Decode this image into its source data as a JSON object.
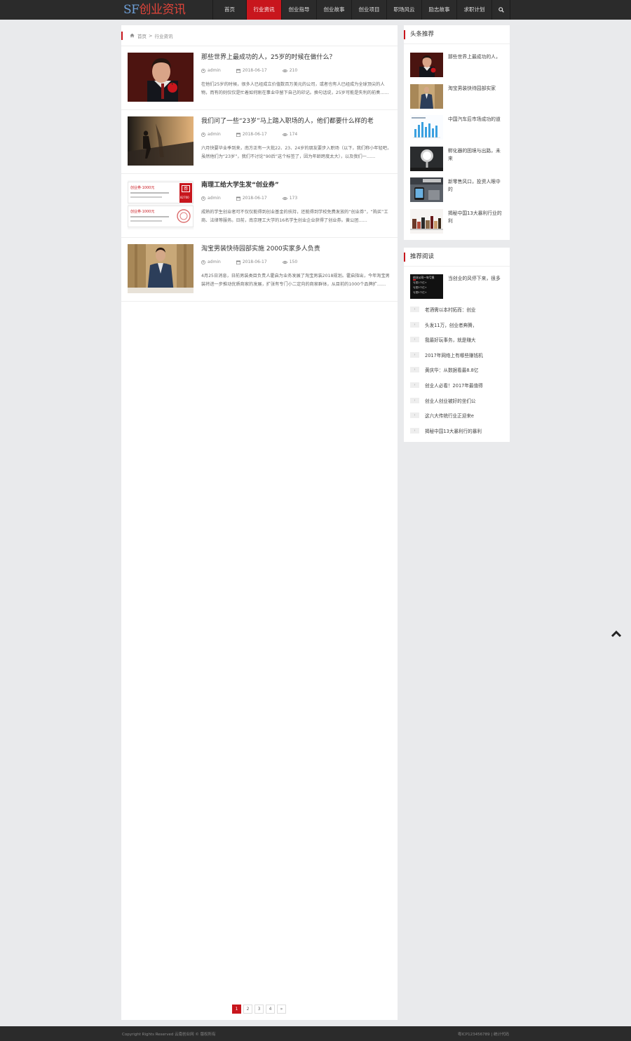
{
  "logo": {
    "sf": "SF",
    "cn": "创业资讯"
  },
  "nav": {
    "items": [
      "首页",
      "行业资讯",
      "创业指导",
      "创业故事",
      "创业项目",
      "职场风云",
      "励志故事",
      "求职计划"
    ],
    "active_index": 1
  },
  "breadcrumb": {
    "home": "首页",
    "separator": ">",
    "current": "行业资讯"
  },
  "articles": [
    {
      "title": "那些世界上最成功的人，25岁的时候在做什么？",
      "author": "admin",
      "date": "2018-06-17",
      "views": "210",
      "excerpt": "在他们25岁的时候，很多人已经成立价值数百万美元的公司，或者也有人已经成为全球顶尖的人物，而有的则仅仅是忙着如何刚在事业中留下自己的印记。换句话说，25岁可能是失利的前奏……"
    },
    {
      "title": "我们问了一些“23岁”马上踏入职场的人，他们都要什么样的老",
      "author": "admin",
      "date": "2018-06-17",
      "views": "174",
      "excerpt": "六月快要毕业季到来，南方正有一大批22、23、24岁的朋友要步入职场（以下，我们称小年轻吧，虽然他们为“23岁”，我们不讨论“90后”这个标签了，因为年龄跨度太大），以及我们一……"
    },
    {
      "title": "南理工给大学生发“创业券”",
      "author": "admin",
      "date": "2018-06-17",
      "views": "173",
      "excerpt": "成熟的学生创业者可不仅仅能得到创业基金的扶持，还能得到学校免费发放的“创业券”，“购买”工商、法律等服务。日前，南京理工大学的16名学生创业企业获得了创业券。黄公团……"
    },
    {
      "title": "淘宝男装快待园部实施 2000实家多人负责",
      "author": "admin",
      "date": "2018-06-17",
      "views": "150",
      "excerpt": "4月25日消息，日前男装类目负责人霍启为业务发展了淘宝男装2018规划。霍启指出，今年淘宝男装将进一步推动优质商家的发展，扩张有专门小二定向的商家群体，从目前的1000个品牌扩……"
    }
  ],
  "voucher_image": {
    "line1": "创业券·1000元",
    "line2": "创业券·1000元",
    "stamp": "券",
    "code": "82700"
  },
  "pagination": {
    "pages": [
      "1",
      "2",
      "3",
      "4",
      "»"
    ],
    "active_index": 0
  },
  "headline": {
    "title": "头条推荐",
    "items": [
      "那些世界上最成功的人，",
      "淘宝男装快待园部实家",
      "中国汽车后市场成功的道",
      "孵化器的困境与出路，未来",
      "新零售风口，投资人眼中的",
      "揭秘中国13大暴利行业的利"
    ]
  },
  "recommend": {
    "title": "推荐阅读",
    "top_item": "当创业的风停下来，很多",
    "top_thumb_lines": [
      "创业公司一年亏损",
      "亏损1个亿+",
      "亏损3个亿+",
      "亏损5个亿+"
    ],
    "items": [
      "老酒需以本村拓而：创业",
      "头发11万，创业者奔腾，",
      "我最好玩事务，就是赚大",
      "2017年网络上有哪些赚钱机",
      "黄庆华：从数据看最8.8亿",
      "创业人必看！2017年最值得",
      "创业人创业被好的坐们公",
      "这六大传统行业正迎来e",
      "揭秘中国13大暴利行的暴利"
    ]
  },
  "footer": {
    "copyright": "Copyright Rights Reserved 云南创业网 © 版权所有",
    "icp": "粤ICP123456789 | 统计代码"
  }
}
